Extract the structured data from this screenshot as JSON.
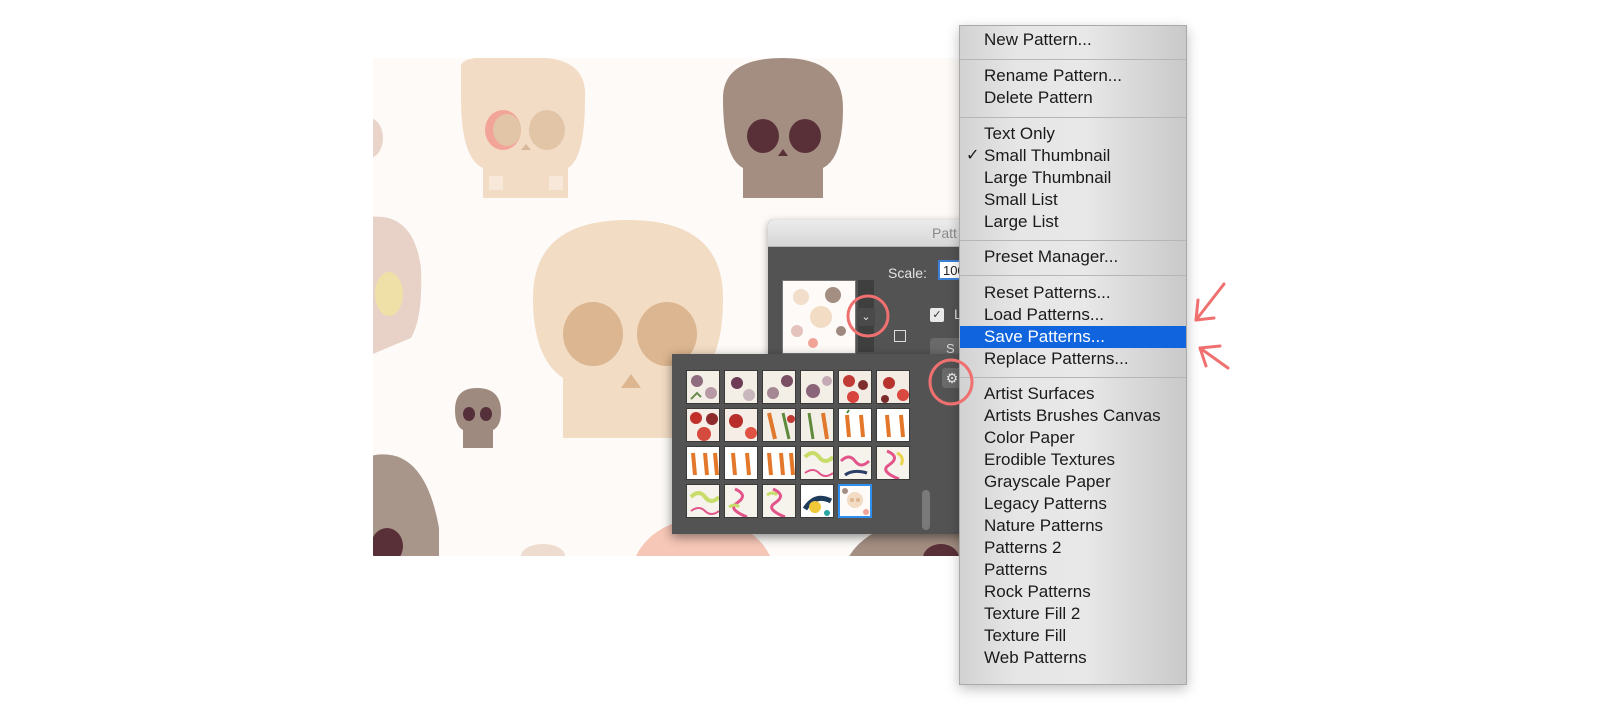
{
  "dialog": {
    "title_partial": "Patt",
    "scale_label": "Scale:",
    "scale_value": "100",
    "checkbox_label_partial": "L",
    "button_partial": "S"
  },
  "context_menu": {
    "items": [
      {
        "label": "New Pattern..."
      },
      {
        "label": "Rename Pattern..."
      },
      {
        "label": "Delete Pattern"
      },
      {
        "label": "Text Only"
      },
      {
        "label": "Small Thumbnail",
        "checked": true
      },
      {
        "label": "Large Thumbnail"
      },
      {
        "label": "Small List"
      },
      {
        "label": "Large List"
      },
      {
        "label": "Preset Manager..."
      },
      {
        "label": "Reset Patterns..."
      },
      {
        "label": "Load Patterns..."
      },
      {
        "label": "Save Patterns...",
        "highlighted": true
      },
      {
        "label": "Replace Patterns..."
      },
      {
        "label": "Artist Surfaces"
      },
      {
        "label": "Artists Brushes Canvas"
      },
      {
        "label": "Color Paper"
      },
      {
        "label": "Erodible Textures"
      },
      {
        "label": "Grayscale Paper"
      },
      {
        "label": "Legacy Patterns"
      },
      {
        "label": "Nature Patterns"
      },
      {
        "label": "Patterns 2"
      },
      {
        "label": "Patterns"
      },
      {
        "label": "Rock Patterns"
      },
      {
        "label": "Texture Fill 2"
      },
      {
        "label": "Texture Fill"
      },
      {
        "label": "Web Patterns"
      }
    ],
    "checkmark": "✓"
  },
  "icons": {
    "gear": "gear-icon",
    "dropdown": "chevron-down-icon",
    "checkbox": "checkbox-icon"
  },
  "colors": {
    "highlight": "#1065de",
    "annotation": "#f07070",
    "panel": "#535353"
  }
}
